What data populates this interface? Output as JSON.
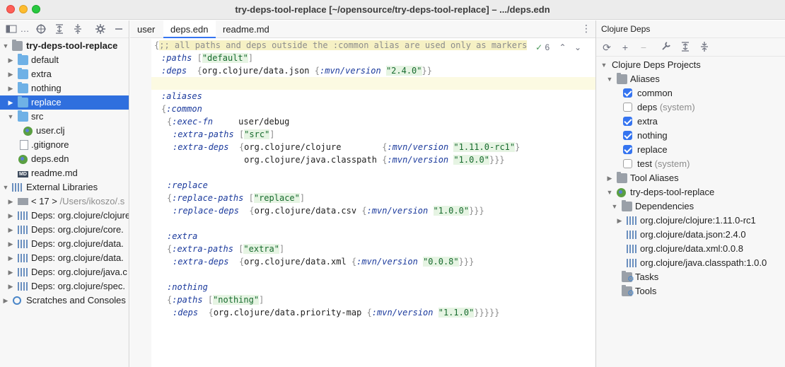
{
  "window": {
    "title": "try-deps-tool-replace [~/opensource/try-deps-tool-replace] – .../deps.edn"
  },
  "colors": {
    "selection": "#2f6fde",
    "folder": "#6fb1e6",
    "keyword": "#1b3a9c",
    "string": "#176b2e",
    "checkbox": "#3574f0"
  },
  "project_panel": {
    "toolbar_icons": [
      "project-view-icon",
      "locate-icon",
      "expand-all-icon",
      "collapse-all-icon",
      "settings-icon",
      "hide-icon"
    ],
    "tree": [
      {
        "label": "try-deps-tool-replace",
        "bold": true
      },
      {
        "label": "default"
      },
      {
        "label": "extra"
      },
      {
        "label": "nothing"
      },
      {
        "label": "replace",
        "selected": true
      },
      {
        "label": "src"
      },
      {
        "label": "user.clj"
      },
      {
        "label": ".gitignore"
      },
      {
        "label": "deps.edn"
      },
      {
        "label": "readme.md"
      },
      {
        "label": "External Libraries"
      },
      {
        "label": "< 17 >",
        "dim": "/Users/ikoszo/.s"
      },
      {
        "label": "Deps: org.clojure/clojure"
      },
      {
        "label": "Deps: org.clojure/core."
      },
      {
        "label": "Deps: org.clojure/data."
      },
      {
        "label": "Deps: org.clojure/data."
      },
      {
        "label": "Deps: org.clojure/java.c"
      },
      {
        "label": "Deps: org.clojure/spec."
      },
      {
        "label": "Scratches and Consoles"
      }
    ]
  },
  "editor": {
    "tabs": [
      "user",
      "deps.edn",
      "readme.md"
    ],
    "active_tab": "deps.edn",
    "inspection_count": "6",
    "lines": [
      {
        "indent": 0,
        "parts": [
          [
            "br",
            "{"
          ],
          [
            "cmt",
            ";; all paths and deps outside the :common alias are used only as markers"
          ]
        ]
      },
      {
        "indent": 1,
        "parts": [
          [
            "kw",
            ":paths"
          ],
          [
            "t",
            " "
          ],
          [
            "br",
            "["
          ],
          [
            "str",
            "\"default\""
          ],
          [
            "br",
            "]"
          ]
        ]
      },
      {
        "indent": 1,
        "parts": [
          [
            "kw",
            ":deps"
          ],
          [
            "t",
            "  "
          ],
          [
            "br",
            "{"
          ],
          [
            "t",
            "org.clojure/data.json "
          ],
          [
            "br",
            "{"
          ],
          [
            "kw",
            ":mvn/version"
          ],
          [
            "t",
            " "
          ],
          [
            "str",
            "\"2.4.0\""
          ],
          [
            "br",
            "}}"
          ]
        ]
      },
      {
        "indent": 0,
        "parts": []
      },
      {
        "indent": 1,
        "parts": [
          [
            "kw",
            ":aliases"
          ]
        ]
      },
      {
        "indent": 1,
        "parts": [
          [
            "br",
            "{"
          ],
          [
            "kw",
            ":common"
          ]
        ]
      },
      {
        "indent": 2,
        "parts": [
          [
            "br",
            "{"
          ],
          [
            "kw",
            ":exec-fn"
          ],
          [
            "t",
            "     user/debug"
          ]
        ]
      },
      {
        "indent": 3,
        "parts": [
          [
            "kw",
            ":extra-paths"
          ],
          [
            "t",
            " "
          ],
          [
            "br",
            "["
          ],
          [
            "str",
            "\"src\""
          ],
          [
            "br",
            "]"
          ]
        ]
      },
      {
        "indent": 3,
        "parts": [
          [
            "kw",
            ":extra-deps"
          ],
          [
            "t",
            "  "
          ],
          [
            "br",
            "{"
          ],
          [
            "t",
            "org.clojure/clojure        "
          ],
          [
            "br",
            "{"
          ],
          [
            "kw",
            ":mvn/version"
          ],
          [
            "t",
            " "
          ],
          [
            "str",
            "\"1.11.0-rc1\""
          ],
          [
            "br",
            "}"
          ]
        ]
      },
      {
        "indent": 3,
        "parts": [
          [
            "t",
            "              org.clojure/java.classpath "
          ],
          [
            "br",
            "{"
          ],
          [
            "kw",
            ":mvn/version"
          ],
          [
            "t",
            " "
          ],
          [
            "str",
            "\"1.0.0\""
          ],
          [
            "br",
            "}}}"
          ]
        ]
      },
      {
        "indent": 0,
        "parts": []
      },
      {
        "indent": 2,
        "parts": [
          [
            "kw",
            ":replace"
          ]
        ]
      },
      {
        "indent": 2,
        "parts": [
          [
            "br",
            "{"
          ],
          [
            "kw",
            ":replace-paths"
          ],
          [
            "t",
            " "
          ],
          [
            "br",
            "["
          ],
          [
            "str",
            "\"replace\""
          ],
          [
            "br",
            "]"
          ]
        ]
      },
      {
        "indent": 3,
        "parts": [
          [
            "kw",
            ":replace-deps"
          ],
          [
            "t",
            "  "
          ],
          [
            "br",
            "{"
          ],
          [
            "t",
            "org.clojure/data.csv "
          ],
          [
            "br",
            "{"
          ],
          [
            "kw",
            ":mvn/version"
          ],
          [
            "t",
            " "
          ],
          [
            "str",
            "\"1.0.0\""
          ],
          [
            "br",
            "}}}"
          ]
        ]
      },
      {
        "indent": 0,
        "parts": []
      },
      {
        "indent": 2,
        "parts": [
          [
            "kw",
            ":extra"
          ]
        ]
      },
      {
        "indent": 2,
        "parts": [
          [
            "br",
            "{"
          ],
          [
            "kw",
            ":extra-paths"
          ],
          [
            "t",
            " "
          ],
          [
            "br",
            "["
          ],
          [
            "str",
            "\"extra\""
          ],
          [
            "br",
            "]"
          ]
        ]
      },
      {
        "indent": 3,
        "parts": [
          [
            "kw",
            ":extra-deps"
          ],
          [
            "t",
            "  "
          ],
          [
            "br",
            "{"
          ],
          [
            "t",
            "org.clojure/data.xml "
          ],
          [
            "br",
            "{"
          ],
          [
            "kw",
            ":mvn/version"
          ],
          [
            "t",
            " "
          ],
          [
            "str",
            "\"0.0.8\""
          ],
          [
            "br",
            "}}}"
          ]
        ]
      },
      {
        "indent": 0,
        "parts": []
      },
      {
        "indent": 2,
        "parts": [
          [
            "kw",
            ":nothing"
          ]
        ]
      },
      {
        "indent": 2,
        "parts": [
          [
            "br",
            "{"
          ],
          [
            "kw",
            ":paths"
          ],
          [
            "t",
            " "
          ],
          [
            "br",
            "["
          ],
          [
            "str",
            "\"nothing\""
          ],
          [
            "br",
            "]"
          ]
        ]
      },
      {
        "indent": 3,
        "parts": [
          [
            "kw",
            ":deps"
          ],
          [
            "t",
            "  "
          ],
          [
            "br",
            "{"
          ],
          [
            "t",
            "org.clojure/data.priority-map "
          ],
          [
            "br",
            "{"
          ],
          [
            "kw",
            ":mvn/version"
          ],
          [
            "t",
            " "
          ],
          [
            "str",
            "\"1.1.0\""
          ],
          [
            "br",
            "}}}}}"
          ]
        ]
      }
    ]
  },
  "deps_panel": {
    "title": "Clojure Deps",
    "toolbar_icons": [
      "refresh-icon",
      "add-icon",
      "remove-icon",
      "wrench-icon",
      "expand-all-icon",
      "collapse-all-icon"
    ],
    "tree": [
      {
        "label": "Clojure Deps Projects"
      },
      {
        "label": "Aliases"
      },
      {
        "label": "common",
        "checked": true
      },
      {
        "label": "deps",
        "dim": "(system)",
        "checked": false
      },
      {
        "label": "extra",
        "checked": true
      },
      {
        "label": "nothing",
        "checked": true
      },
      {
        "label": "replace",
        "checked": true
      },
      {
        "label": "test",
        "dim": "(system)",
        "checked": false
      },
      {
        "label": "Tool Aliases"
      },
      {
        "label": "try-deps-tool-replace"
      },
      {
        "label": "Dependencies"
      },
      {
        "label": "org.clojure/clojure:1.11.0-rc1"
      },
      {
        "label": "org.clojure/data.json:2.4.0"
      },
      {
        "label": "org.clojure/data.xml:0.0.8"
      },
      {
        "label": "org.clojure/java.classpath:1.0.0"
      },
      {
        "label": "Tasks"
      },
      {
        "label": "Tools"
      }
    ]
  }
}
